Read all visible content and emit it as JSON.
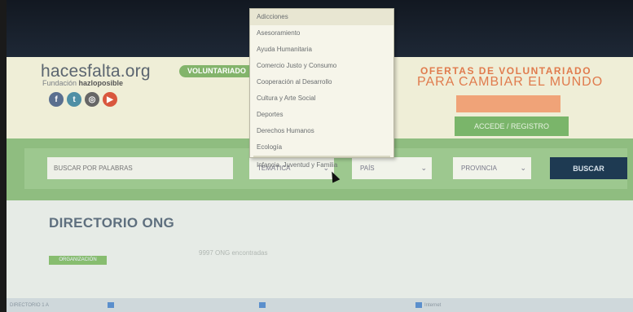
{
  "site": {
    "logo": "hacesfalta.org",
    "fundacion_prefix": "Fundación",
    "fundacion_name": "hazloposible",
    "volunteer_tab": "VOLUNTARIADO",
    "social_icons": [
      "facebook-icon",
      "twitter-icon",
      "instagram-icon",
      "youtube-icon"
    ]
  },
  "promo": {
    "title": "OFERTAS DE VOLUNTARIADO",
    "subtitle": "PARA CAMBIAR EL MUNDO",
    "publish_button": "",
    "register_button": "ACCEDE / REGISTRO"
  },
  "search": {
    "input_placeholder": "BUSCAR POR PALABRAS",
    "filter1_value": "TEMÁTICA",
    "filter2_value": "PAÍS",
    "filter3_value": "PROVINCIA",
    "button_label": "BUSCAR"
  },
  "dropdown": {
    "items": [
      "Adicciones",
      "Asesoramiento",
      "Ayuda Humanitaria",
      "Comercio Justo y Consumo",
      "Cooperación al Desarrollo",
      "Cultura y Arte Social",
      "Deportes",
      "Derechos Humanos",
      "Ecología",
      "Infancia, Juventud y Familia"
    ],
    "highlighted_index": 0
  },
  "main": {
    "heading": "DIRECTORIO ONG",
    "badge": "ORGANIZACIÓN",
    "note": "9997 ONG encontradas"
  },
  "taskbar": {
    "items": [
      "DIRECTORIO 1 A",
      "",
      "",
      "Internet"
    ]
  },
  "colors": {
    "accent_orange": "#e07b4d",
    "accent_green": "#7ab56a",
    "search_button": "#1e3a52"
  }
}
